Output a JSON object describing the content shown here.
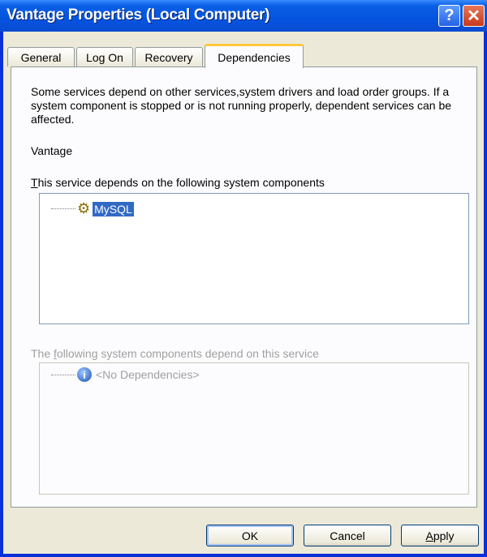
{
  "window": {
    "title": "Vantage Properties (Local Computer)"
  },
  "titlebar_buttons": {
    "help": "?",
    "close": "✕"
  },
  "tabs": [
    {
      "label": "General",
      "active": false
    },
    {
      "label": "Log On",
      "active": false
    },
    {
      "label": "Recovery",
      "active": false
    },
    {
      "label": "Dependencies",
      "active": true
    }
  ],
  "dependencies": {
    "description": "Some services depend on other services,system drivers and load order groups. If a system component is stopped or is not running properly, dependent services can be affected.",
    "service_name": "Vantage",
    "depends_on_label_first": "T",
    "depends_on_label_rest": "his service depends on the following system components",
    "depends_on_items": [
      {
        "label": "MySQL",
        "icon": "service-gear-icon",
        "selected": true
      }
    ],
    "dependents_label_start": "The ",
    "dependents_label_ul": "f",
    "dependents_label_rest": "ollowing system components depend on this service",
    "dependents_items": [
      {
        "label": "<No Dependencies>",
        "icon": "info-icon"
      }
    ]
  },
  "buttons": {
    "ok": "OK",
    "cancel": "Cancel",
    "apply_first": "A",
    "apply_rest": "pply"
  },
  "colors": {
    "titlebar": "#0454e0",
    "selection": "#316ac5",
    "active_tab_accent": "#ffc83c",
    "background": "#ece9d8"
  }
}
